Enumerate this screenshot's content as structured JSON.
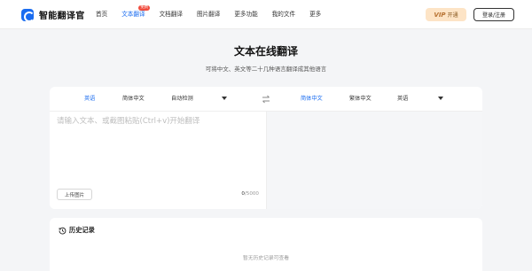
{
  "brand": {
    "name": "智能翻译官"
  },
  "nav": {
    "items": [
      {
        "label": "首页",
        "active": false
      },
      {
        "label": "文本翻译",
        "active": true,
        "badge": "免费"
      },
      {
        "label": "文档翻译",
        "active": false
      },
      {
        "label": "图片翻译",
        "active": false
      },
      {
        "label": "更多功能",
        "active": false
      },
      {
        "label": "我的文件",
        "active": false
      },
      {
        "label": "更多",
        "active": false
      }
    ],
    "vip_mark": "VIP",
    "vip_label": "开通",
    "login_label": "登录/注册"
  },
  "hero": {
    "title": "文本在线翻译",
    "subtitle": "可将中文、英文等二十几种语言翻译成其他语言"
  },
  "translator": {
    "source_langs": [
      "英语",
      "简体中文",
      "自动检测"
    ],
    "source_active": "英语",
    "target_langs": [
      "简体中文",
      "繁体中文",
      "英语"
    ],
    "target_active": "简体中文",
    "input_value": "",
    "input_placeholder": "请输入文本、或截图粘贴(Ctrl+v)开始翻译",
    "upload_label": "上传图片",
    "char_current": "0",
    "char_max": "/5000"
  },
  "history": {
    "title": "历史记录",
    "empty_text": "暂无历史记录可查看"
  },
  "colors": {
    "accent": "#1a6cf0",
    "badge": "#f04c3e",
    "vip_bg": "#fde4c6",
    "page_bg": "#f4f5f7"
  },
  "icons": {
    "logo": "translate-logo-icon",
    "swap": "swap-arrows-icon",
    "dropdown": "caret-down-icon",
    "history": "clock-history-icon"
  }
}
